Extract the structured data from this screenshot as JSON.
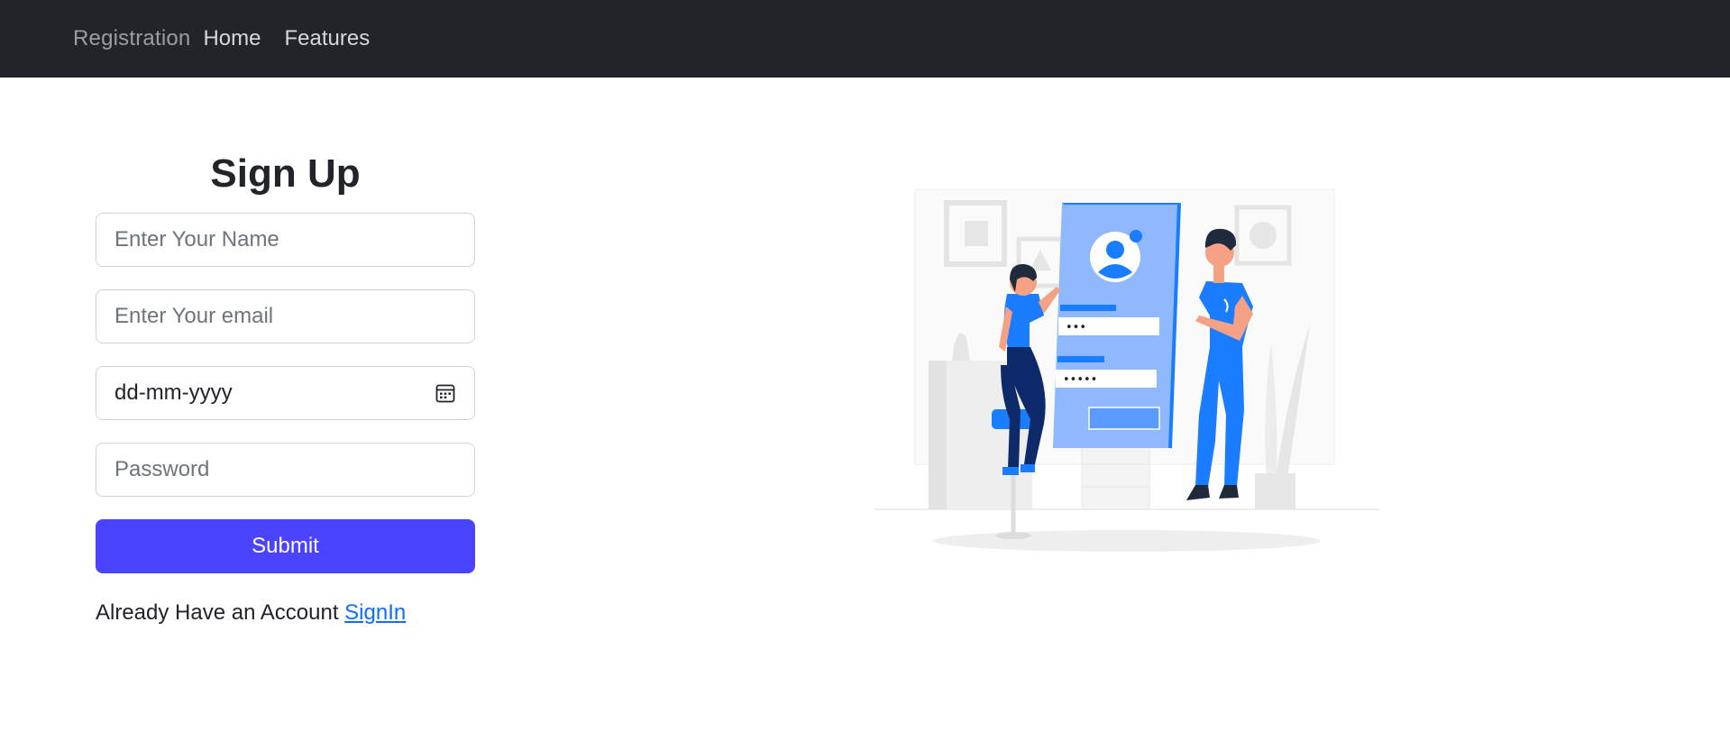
{
  "navbar": {
    "brand": "Registration",
    "links": [
      "Home",
      "Features"
    ]
  },
  "form": {
    "title": "Sign Up",
    "name_placeholder": "Enter Your Name",
    "email_placeholder": "Enter Your email",
    "date_value": "dd-mm-yyyy",
    "password_placeholder": "Password",
    "submit_label": "Submit",
    "account_text": "Already Have an Account ",
    "signin_label": "SignIn"
  },
  "illustration": {
    "password_dots_1": "•••",
    "password_dots_2": "•••••"
  },
  "colors": {
    "navbar_bg": "#212529",
    "submit_bg": "#4a43ff",
    "link": "#0d6efd",
    "illustration_blue": "#1a7cff"
  }
}
